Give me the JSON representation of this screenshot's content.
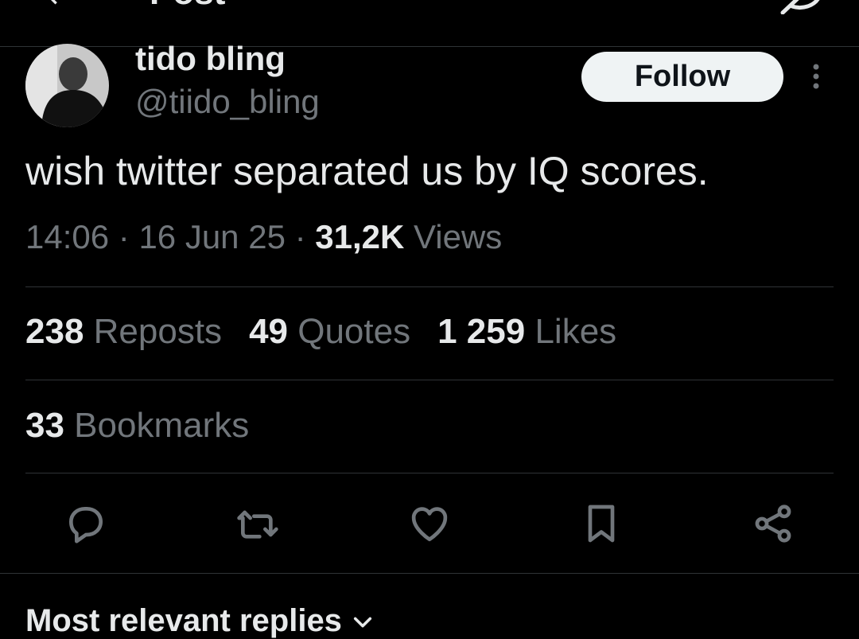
{
  "header": {
    "title": "Post",
    "back_icon": "back-arrow-icon",
    "grok_icon": "grok-icon"
  },
  "author": {
    "name": "tido bling",
    "handle": "@tiido_bling",
    "follow_label": "Follow",
    "avatar_icon": "avatar"
  },
  "tweet": {
    "text": "wish twitter separated us by IQ scores.",
    "time": "14:06",
    "sep1": " · ",
    "date": "16 Jun 25",
    "sep2": " · ",
    "views_count": "31,2K",
    "views_label": " Views"
  },
  "stats": {
    "reposts_count": "238",
    "reposts_label": " Reposts",
    "quotes_count": "49",
    "quotes_label": " Quotes",
    "likes_count": "1 259",
    "likes_label": " Likes",
    "bookmarks_count": "33",
    "bookmarks_label": " Bookmarks"
  },
  "actions": [
    "reply-icon",
    "repost-icon",
    "like-icon",
    "bookmark-icon",
    "share-icon"
  ],
  "replies": {
    "heading": "Most relevant replies"
  },
  "colors": {
    "background": "#000000",
    "text": "#e7e9ea",
    "muted": "#71767b",
    "divider": "#2f3336",
    "icon": "#71767b"
  }
}
